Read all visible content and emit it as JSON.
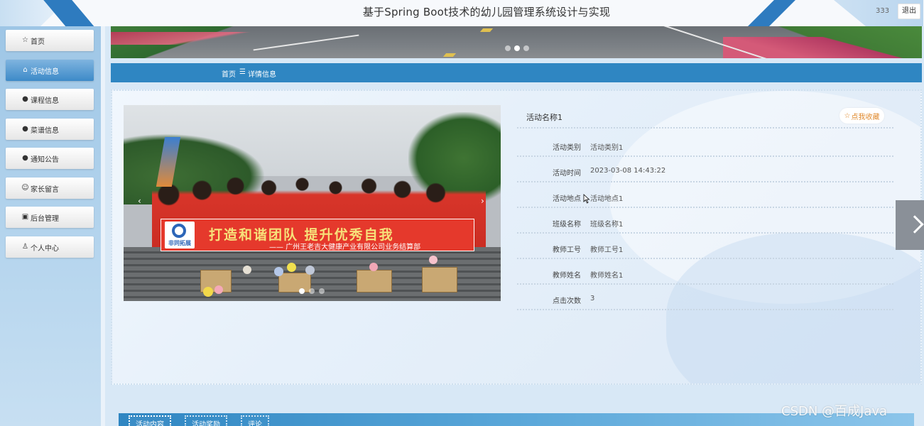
{
  "header": {
    "title": "基于Spring Boot技术的幼儿园管理系统设计与实现",
    "username": "333",
    "logout_label": "退出"
  },
  "sidebar": {
    "items": [
      {
        "label": "首页",
        "icon": "star-outline-icon",
        "active": false
      },
      {
        "label": "活动信息",
        "icon": "home-icon",
        "active": true
      },
      {
        "label": "课程信息",
        "icon": "info-circle-icon",
        "active": false
      },
      {
        "label": "菜谱信息",
        "icon": "question-circle-icon",
        "active": false
      },
      {
        "label": "通知公告",
        "icon": "compass-icon",
        "active": false
      },
      {
        "label": "家长留言",
        "icon": "smile-icon",
        "active": false
      },
      {
        "label": "后台管理",
        "icon": "briefcase-icon",
        "active": false
      },
      {
        "label": "个人中心",
        "icon": "user-icon",
        "active": false
      }
    ]
  },
  "banner": {
    "active_slide": 2,
    "slide_count": 3
  },
  "breadcrumb": {
    "home": "首页",
    "separator": "☰",
    "current": "详情信息"
  },
  "photo": {
    "banner_text": "打造和谐团队  提升优秀自我",
    "banner_subtext": "—— 广州王老吉大健康产业有限公司业务结算部",
    "logo_text": "非同拓展",
    "active_slide": 1,
    "slide_count": 3
  },
  "detail": {
    "title": "活动名称1",
    "favorite_label": "点我收藏",
    "rows": [
      {
        "label": "活动类别",
        "value": "活动类别1"
      },
      {
        "label": "活动时间",
        "value": "2023-03-08 14:43:22"
      },
      {
        "label": "活动地点",
        "value": "活动地点1"
      },
      {
        "label": "班级名称",
        "value": "班级名称1"
      },
      {
        "label": "教师工号",
        "value": "教师工号1"
      },
      {
        "label": "教师姓名",
        "value": "教师姓名1"
      },
      {
        "label": "点击次数",
        "value": "3"
      }
    ]
  },
  "tabs": [
    {
      "label": "活动内容",
      "active": true
    },
    {
      "label": "活动奖励",
      "active": false
    },
    {
      "label": "评论",
      "active": false
    }
  ],
  "watermark": "CSDN @百成Java",
  "colors": {
    "primary": "#2f86c2",
    "active_nav": "#3d8ac8",
    "favorite": "#e08a2e"
  }
}
